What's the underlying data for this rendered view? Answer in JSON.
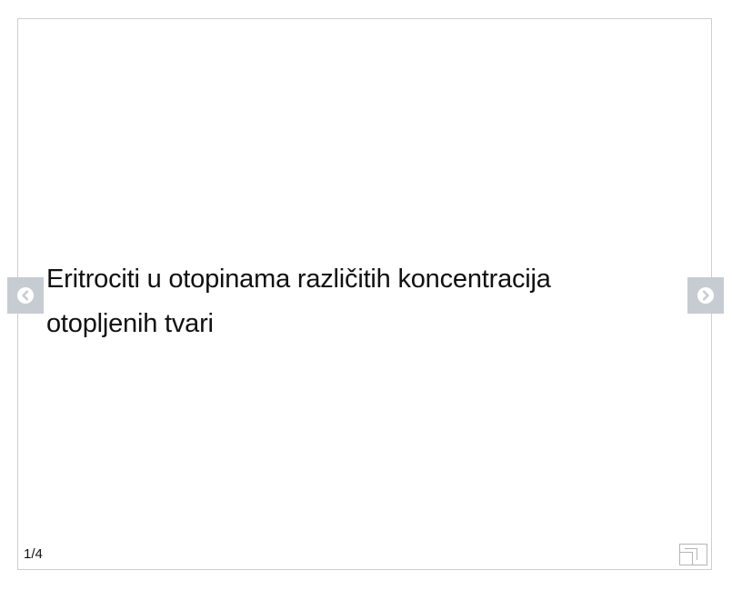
{
  "slide": {
    "title": "Eritrociti u otopinama različitih koncentracija otopljenih tvari",
    "counter": "1/4"
  },
  "controls": {
    "prev_icon": "chevron-left-circle-icon",
    "next_icon": "chevron-right-circle-icon",
    "fullscreen_icon": "fullscreen-icon"
  },
  "colors": {
    "nav_button_bg": "#c7ccd2",
    "nav_icon_fg": "#ffffff",
    "frame_border": "#cfcfcf",
    "text": "#111111"
  }
}
